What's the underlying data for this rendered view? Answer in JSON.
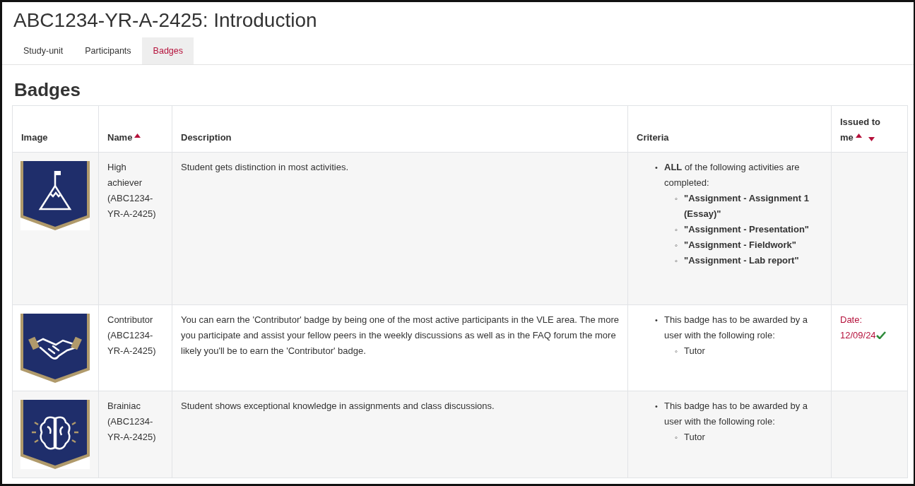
{
  "page_title": "ABC1234-YR-A-2425: Introduction",
  "tabs": [
    {
      "label": "Study-unit",
      "selected": false
    },
    {
      "label": "Participants",
      "selected": false
    },
    {
      "label": "Badges",
      "selected": true
    }
  ],
  "heading": "Badges",
  "table": {
    "columns": [
      {
        "label": "Image",
        "sort_asc": false,
        "sort_desc": false
      },
      {
        "label": "Name",
        "sort_asc": true,
        "sort_desc": false
      },
      {
        "label": "Description",
        "sort_asc": false,
        "sort_desc": false
      },
      {
        "label": "Criteria",
        "sort_asc": false,
        "sort_desc": false
      },
      {
        "label": "Issued to me",
        "sort_asc": true,
        "sort_desc": true
      }
    ],
    "rows": [
      {
        "name": "High achiever (ABC1234-YR-A-2425)",
        "description": "Student gets distinction in most activities.",
        "criteria": [
          {
            "bullet": "•",
            "text": "**ALL** of the following activities are completed:",
            "children": [
              {
                "bullet": "◦",
                "text": "\"Assignment - Assignment 1 (Essay)\"",
                "bold": true
              },
              {
                "bullet": "◦",
                "text": "\"Assignment - Presentation\"",
                "bold": true
              },
              {
                "bullet": "◦",
                "text": "\"Assignment - Fieldwork\"",
                "bold": true
              },
              {
                "bullet": "◦",
                "text": "\"Assignment - Lab report\"",
                "bold": true
              }
            ]
          }
        ]
      },
      {
        "name": "Contributor (ABC1234-YR-A-2425)",
        "description": "You can earn the 'Contributor' badge by being one of the most active participants in the VLE area. The more you participate and assist your fellow peers in the weekly discussions as well as in the FAQ forum the more likely you'll be to earn the 'Contributor' badge.",
        "criteria": [
          {
            "bullet": "•",
            "text": "This badge has to be awarded by a user with the following role:",
            "children": [
              {
                "bullet": "◦",
                "text": "Tutor",
                "bold": false
              }
            ]
          }
        ],
        "issued": {
          "date": "Date: 12/09/24",
          "checked": true
        }
      },
      {
        "name": "Brainiac (ABC1234-YR-A-2425)",
        "description": "Student shows exceptional knowledge in assignments and class discussions.",
        "criteria": [
          {
            "bullet": "•",
            "text": "This badge has to be awarded by a user with the following role:",
            "children": [
              {
                "bullet": "◦",
                "text": "Tutor",
                "bold": false
              }
            ]
          }
        ]
      }
    ]
  }
}
